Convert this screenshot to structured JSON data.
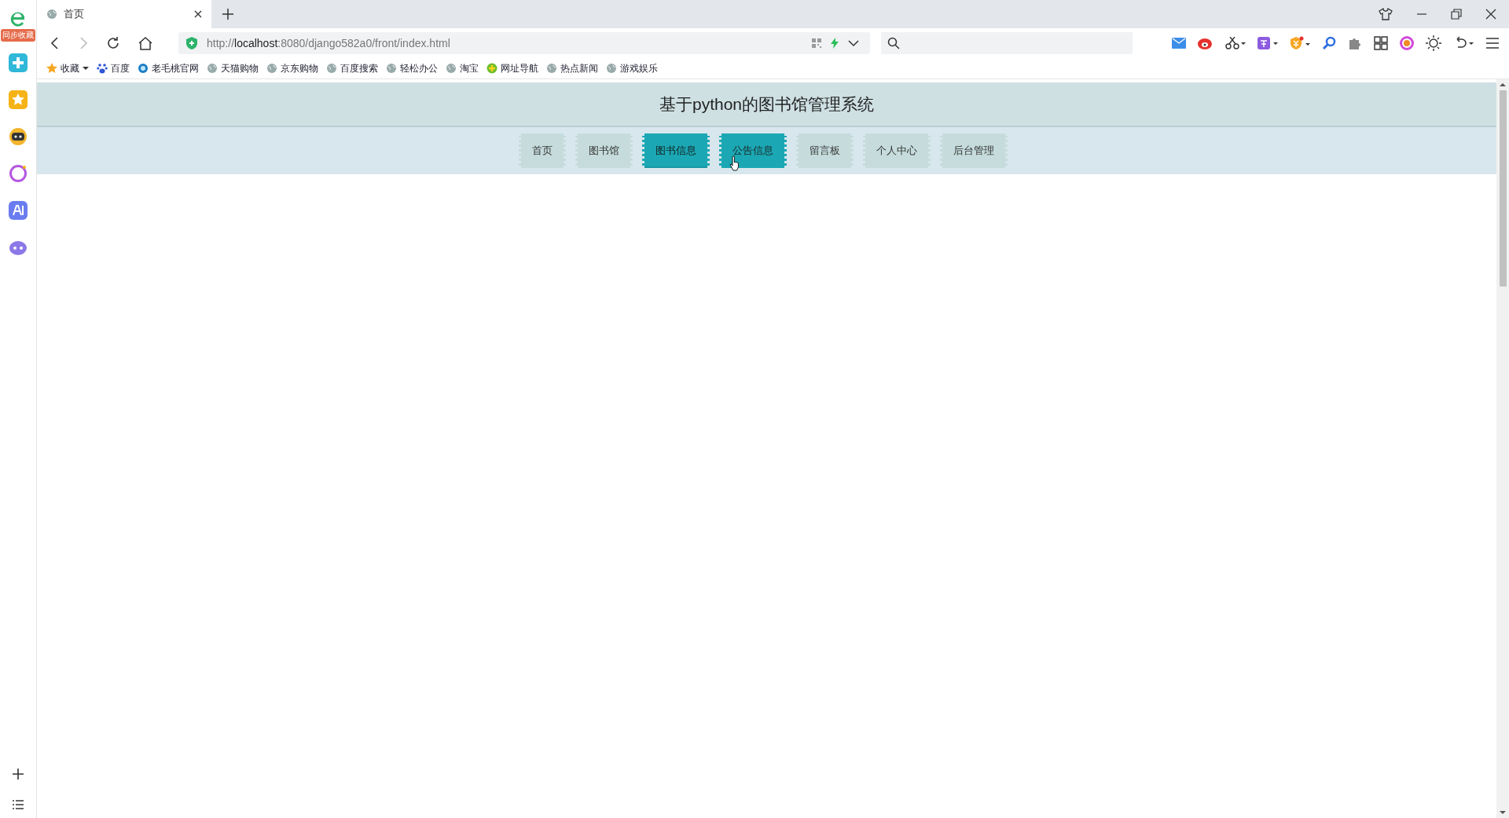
{
  "sidebar": {
    "badge": "同步收藏"
  },
  "tab": {
    "title": "首页"
  },
  "address": "http://**localhost**:8080/django582a0/front/index.html",
  "bookmarks": [
    {
      "label": "收藏",
      "kind": "star"
    },
    {
      "label": "百度",
      "kind": "paw"
    },
    {
      "label": "老毛桃官网",
      "kind": "ring"
    },
    {
      "label": "天猫购物",
      "kind": "globe"
    },
    {
      "label": "京东购物",
      "kind": "globe"
    },
    {
      "label": "百度搜索",
      "kind": "globe"
    },
    {
      "label": "轻松办公",
      "kind": "globe"
    },
    {
      "label": "淘宝",
      "kind": "globe"
    },
    {
      "label": "网址导航",
      "kind": "plus"
    },
    {
      "label": "热点新闻",
      "kind": "globe"
    },
    {
      "label": "游戏娱乐",
      "kind": "globe"
    }
  ],
  "page": {
    "title": "基于python的图书馆管理系统",
    "nav": [
      {
        "label": "首页",
        "selected": false,
        "hovered": false
      },
      {
        "label": "图书馆",
        "selected": false,
        "hovered": false
      },
      {
        "label": "图书信息",
        "selected": true,
        "hovered": false
      },
      {
        "label": "公告信息",
        "selected": false,
        "hovered": true
      },
      {
        "label": "留言板",
        "selected": false,
        "hovered": false
      },
      {
        "label": "个人中心",
        "selected": false,
        "hovered": false
      },
      {
        "label": "后台管理",
        "selected": false,
        "hovered": false
      }
    ]
  }
}
